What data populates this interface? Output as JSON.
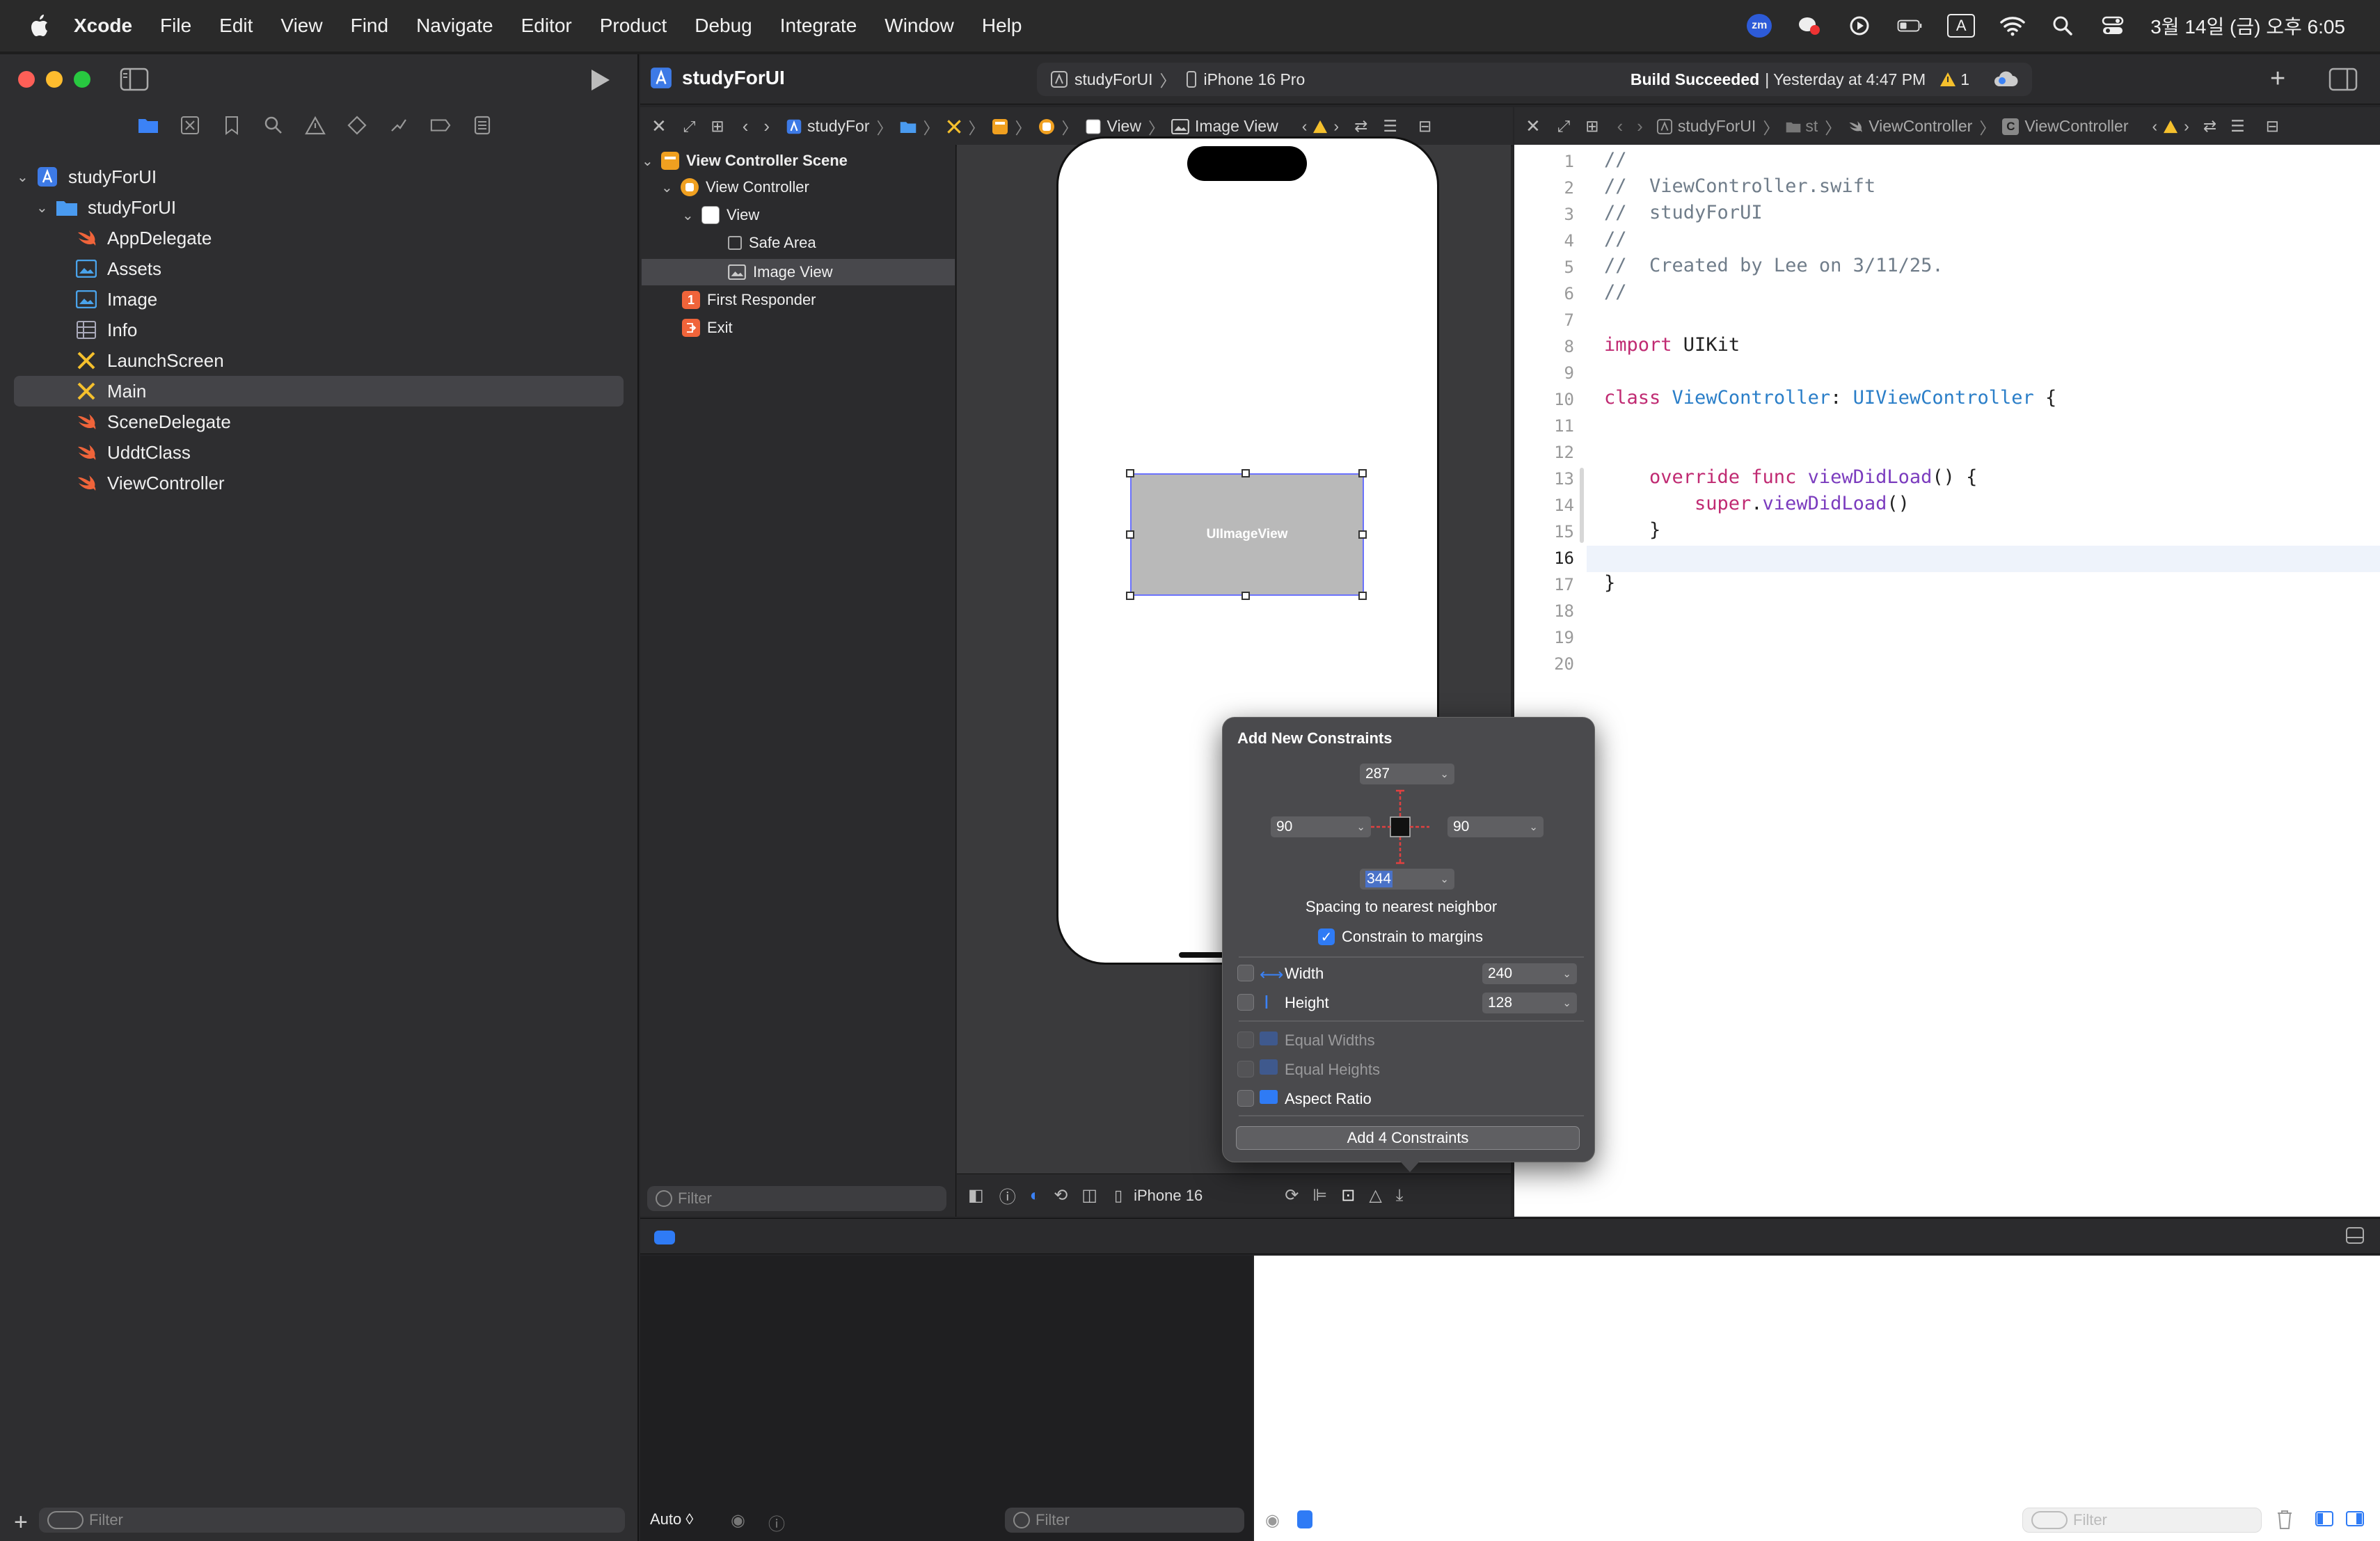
{
  "menubar": {
    "items": [
      "Xcode",
      "File",
      "Edit",
      "View",
      "Find",
      "Navigate",
      "Editor",
      "Product",
      "Debug",
      "Integrate",
      "Window",
      "Help"
    ],
    "clock": "3월 14일 (금) 오후 6:05",
    "input_indicator": "A",
    "zoom_badge": "zm"
  },
  "toolbar": {
    "project_title": "studyForUI",
    "scheme": "studyForUI",
    "device": "iPhone 16 Pro",
    "status_bold": "Build Succeeded",
    "status_rest": "| Yesterday at 4:47 PM",
    "warning_count": "1"
  },
  "navigator": {
    "project": "studyForUI",
    "group": "studyForUI",
    "files": [
      {
        "name": "AppDelegate",
        "icon": "swift-file-icon"
      },
      {
        "name": "Assets",
        "icon": "asset-catalog-icon"
      },
      {
        "name": "Image",
        "icon": "asset-catalog-icon"
      },
      {
        "name": "Info",
        "icon": "plist-table-icon"
      },
      {
        "name": "LaunchScreen",
        "icon": "storyboard-icon"
      },
      {
        "name": "Main",
        "icon": "storyboard-icon"
      },
      {
        "name": "SceneDelegate",
        "icon": "swift-file-icon"
      },
      {
        "name": "UddtClass",
        "icon": "swift-file-icon"
      },
      {
        "name": "ViewController",
        "icon": "swift-file-icon"
      }
    ],
    "filter_placeholder": "Filter"
  },
  "jumpbar_ib": {
    "crumbs": [
      "studyFor",
      "View",
      "Image View"
    ]
  },
  "outline": {
    "scene": "View Controller Scene",
    "controller": "View Controller",
    "view": "View",
    "safe_area": "Safe Area",
    "image_view": "Image View",
    "first_responder": "First Responder",
    "exit": "Exit",
    "filter_placeholder": "Filter"
  },
  "canvas": {
    "image_view_label": "UIImageView",
    "device_label": "iPhone 16"
  },
  "editor_jump": {
    "crumbs": [
      "studyForUI",
      "st",
      "ViewController",
      "ViewController"
    ]
  },
  "code": {
    "line_numbers": [
      "1",
      "2",
      "3",
      "4",
      "5",
      "6",
      "7",
      "8",
      "9",
      "10",
      "11",
      "12",
      "13",
      "14",
      "15",
      "16",
      "17",
      "18",
      "19",
      "20"
    ],
    "l1": "//",
    "l2": "//  ViewController.swift",
    "l3": "//  studyForUI",
    "l4": "//",
    "l5": "//  Created by Lee on 3/11/25.",
    "l6": "//",
    "l8_kw": "import",
    "l8_rest": " UIKit",
    "l10_kw": "class",
    "l10_name": "ViewController",
    "l10_colon": ": ",
    "l10_super": "UIViewController",
    "l10_brace": " {",
    "l13_kw": "override func",
    "l13_fn": "viewDidLoad",
    "l13_rest": "() {",
    "l14_kw": "super",
    "l14_dot": ".",
    "l14_fn": "viewDidLoad",
    "l14_rest": "()",
    "l15": "}",
    "l17": "}"
  },
  "popover": {
    "title": "Add New Constraints",
    "top": "287",
    "left": "90",
    "right": "90",
    "bottom": "344",
    "spacing_label": "Spacing to nearest neighbor",
    "constrain_margins": "Constrain to margins",
    "constrain_margins_checked": true,
    "width_label": "Width",
    "width_value": "240",
    "height_label": "Height",
    "height_value": "128",
    "equal_widths": "Equal Widths",
    "equal_heights": "Equal Heights",
    "aspect_ratio": "Aspect Ratio",
    "add_button": "Add 4 Constraints"
  },
  "debug": {
    "auto_label": "Auto ◊",
    "filter_placeholder": "Filter"
  },
  "colors": {
    "accent": "#2f7bf5",
    "swift_orange": "#f0643a",
    "storyboard_yellow": "#f5c02d",
    "warning": "#f5c02d"
  }
}
